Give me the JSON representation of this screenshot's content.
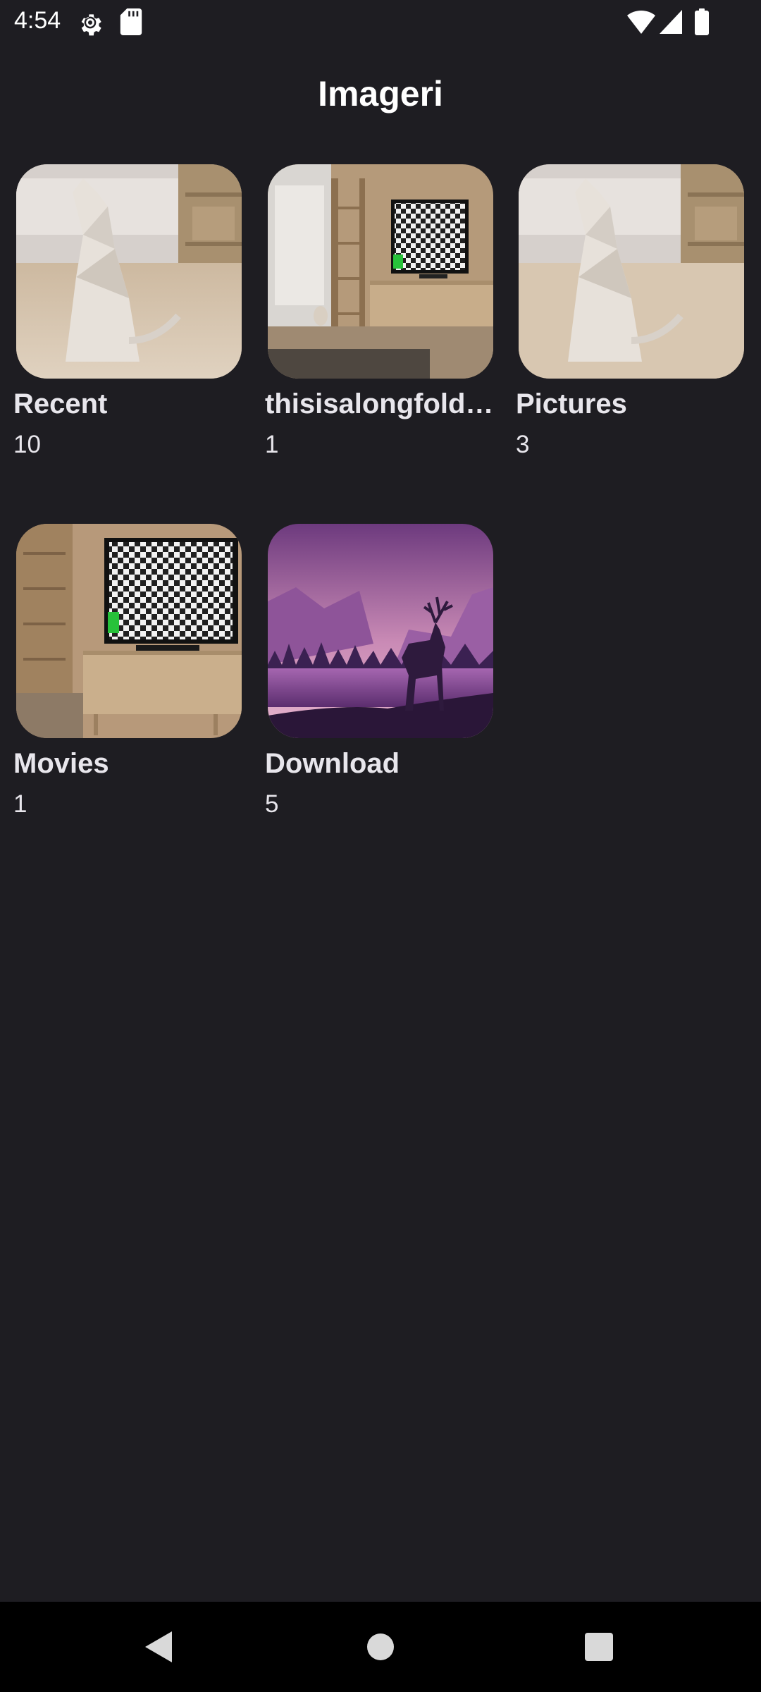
{
  "status_bar": {
    "time": "4:54",
    "icons_left": [
      "settings-gear-icon",
      "sd-card-icon"
    ],
    "icons_right": [
      "wifi-icon",
      "cellular-signal-icon",
      "battery-icon"
    ]
  },
  "app": {
    "title": "Imageri"
  },
  "albums": [
    {
      "name": "Recent",
      "count": "10",
      "thumbnail": "paper-cat-room"
    },
    {
      "name": "thisisalongfold…",
      "count": "1",
      "thumbnail": "tv-room-with-cat"
    },
    {
      "name": "Pictures",
      "count": "3",
      "thumbnail": "paper-cat-room"
    },
    {
      "name": "Movies",
      "count": "1",
      "thumbnail": "tv-cabinet-room"
    },
    {
      "name": "Download",
      "count": "5",
      "thumbnail": "purple-deer-landscape"
    }
  ],
  "nav_bar": {
    "buttons": [
      "back-triangle-icon",
      "home-circle-icon",
      "recents-square-icon"
    ]
  },
  "colors": {
    "background": "#1e1d22",
    "text": "#e8e6ec",
    "nav_background": "#000000"
  }
}
